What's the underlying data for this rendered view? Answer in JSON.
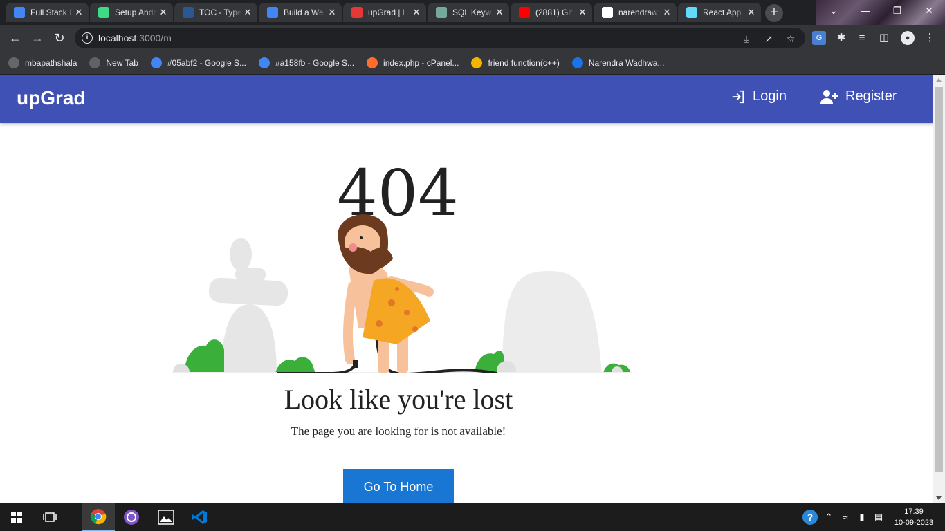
{
  "tabs": [
    {
      "title": "Full Stack D",
      "icon": "google-docs-icon",
      "color": "#4285f4"
    },
    {
      "title": "Setup Andr",
      "icon": "android-icon",
      "color": "#3ddc84"
    },
    {
      "title": "TOC - Type",
      "icon": "s-logo-icon",
      "color": "#2b5797"
    },
    {
      "title": "Build a We",
      "icon": "google-cloud-icon",
      "color": "#4285f4"
    },
    {
      "title": "upGrad | L",
      "icon": "upgrad-icon",
      "color": "#e53935"
    },
    {
      "title": "SQL Keyw",
      "icon": "openai-icon",
      "color": "#74aa9c"
    },
    {
      "title": "(2881) Git",
      "icon": "youtube-icon",
      "color": "#ff0000"
    },
    {
      "title": "narendraw",
      "icon": "github-icon",
      "color": "#ffffff"
    },
    {
      "title": "React App",
      "icon": "react-icon",
      "color": "#61dafb"
    }
  ],
  "address_bar": {
    "host": "localhost",
    "path": ":3000/m"
  },
  "bookmarks": [
    {
      "label": "mbapathshala",
      "icon": "mbapathshala-icon"
    },
    {
      "label": "New Tab",
      "icon": "globe-icon"
    },
    {
      "label": "#05abf2 - Google S...",
      "icon": "google-icon"
    },
    {
      "label": "#a158fb - Google S...",
      "icon": "google-icon"
    },
    {
      "label": "index.php - cPanel...",
      "icon": "cpanel-icon"
    },
    {
      "label": "friend function(c++)",
      "icon": "bookmark-icon"
    },
    {
      "label": "Narendra Wadhwa...",
      "icon": "c-logo-icon"
    }
  ],
  "app": {
    "brand": "upGrad",
    "login_label": "Login",
    "register_label": "Register",
    "appbar_color": "#3f51b5"
  },
  "error": {
    "code": "404",
    "title": "Look like you're lost",
    "subtitle": "The page you are looking for is not available!",
    "home_button": "Go To Home",
    "button_color": "#1976d2"
  },
  "taskbar": {
    "time": "17:39",
    "date": "10-09-2023"
  }
}
